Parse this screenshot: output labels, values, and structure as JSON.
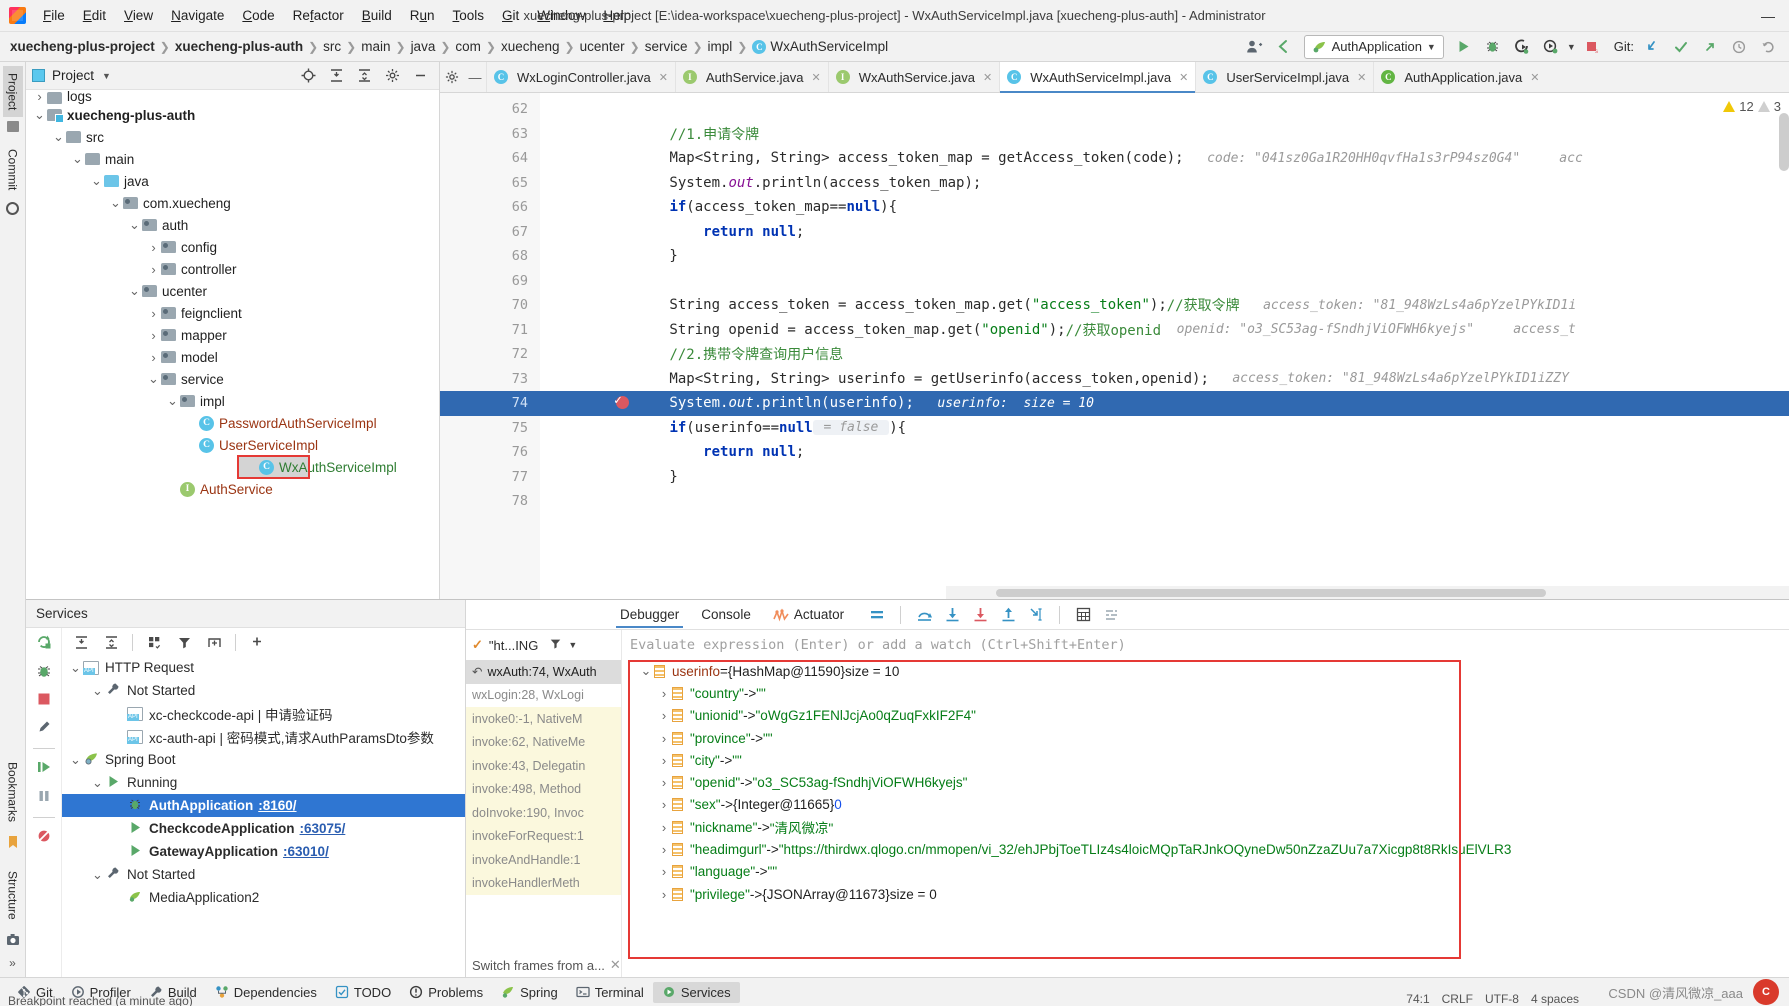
{
  "window": {
    "title": "xuecheng-plus-project [E:\\idea-workspace\\xuecheng-plus-project] - WxAuthServiceImpl.java [xuecheng-plus-auth] - Administrator",
    "minimize": "—",
    "maximize": "❐",
    "close": "✕"
  },
  "menu": [
    "File",
    "Edit",
    "View",
    "Navigate",
    "Code",
    "Refactor",
    "Build",
    "Run",
    "Tools",
    "Git",
    "Window",
    "Help"
  ],
  "breadcrumb": [
    {
      "label": "xuecheng-plus-project",
      "bold": true
    },
    {
      "label": "xuecheng-plus-auth",
      "bold": true
    },
    {
      "label": "src",
      "bold": false
    },
    {
      "label": "main",
      "bold": false
    },
    {
      "label": "java",
      "bold": false
    },
    {
      "label": "com",
      "bold": false
    },
    {
      "label": "xuecheng",
      "bold": false
    },
    {
      "label": "ucenter",
      "bold": false
    },
    {
      "label": "service",
      "bold": false
    },
    {
      "label": "impl",
      "bold": false
    },
    {
      "label": "WxAuthServiceImpl",
      "bold": false,
      "badge": "C"
    }
  ],
  "toolbar": {
    "run_config": "AuthApplication",
    "git_label": "Git:",
    "icons": {
      "avatar": "user-avatar-icon",
      "back": "back-arrow-icon",
      "run": "run-icon",
      "debug": "debug-icon",
      "coverage": "coverage-icon",
      "profile": "profile-icon",
      "stop": "stop-icon",
      "update_project": "update-project-icon",
      "commit": "commit-icon",
      "push": "push-icon",
      "history": "history-icon",
      "rollback": "rollback-icon"
    }
  },
  "project_panel": {
    "title": "Project",
    "tools": [
      "locate-icon",
      "expand-all-icon",
      "collapse-all-icon",
      "settings-icon",
      "hide-icon"
    ],
    "tree": [
      {
        "label": "logs",
        "depth": 2,
        "arrow": "right",
        "icon": "folder-grey",
        "style": "normal",
        "cut": true
      },
      {
        "label": "xuecheng-plus-auth",
        "depth": 2,
        "arrow": "down",
        "icon": "module",
        "style": "bold"
      },
      {
        "label": "src",
        "depth": 3,
        "arrow": "down",
        "icon": "folder-grey",
        "style": "normal"
      },
      {
        "label": "main",
        "depth": 4,
        "arrow": "down",
        "icon": "folder-grey",
        "style": "normal"
      },
      {
        "label": "java",
        "depth": 5,
        "arrow": "down",
        "icon": "folder-blue",
        "style": "normal"
      },
      {
        "label": "com.xuecheng",
        "depth": 6,
        "arrow": "down",
        "icon": "package",
        "style": "normal"
      },
      {
        "label": "auth",
        "depth": 7,
        "arrow": "down",
        "icon": "package",
        "style": "normal"
      },
      {
        "label": "config",
        "depth": 8,
        "arrow": "right",
        "icon": "package",
        "style": "normal"
      },
      {
        "label": "controller",
        "depth": 8,
        "arrow": "right",
        "icon": "package",
        "style": "normal"
      },
      {
        "label": "ucenter",
        "depth": 7,
        "arrow": "down",
        "icon": "package",
        "style": "normal"
      },
      {
        "label": "feignclient",
        "depth": 8,
        "arrow": "right",
        "icon": "package",
        "style": "normal"
      },
      {
        "label": "mapper",
        "depth": 8,
        "arrow": "right",
        "icon": "package",
        "style": "normal"
      },
      {
        "label": "model",
        "depth": 8,
        "arrow": "right",
        "icon": "package",
        "style": "normal"
      },
      {
        "label": "service",
        "depth": 8,
        "arrow": "down",
        "icon": "package",
        "style": "normal"
      },
      {
        "label": "impl",
        "depth": 9,
        "arrow": "down",
        "icon": "package",
        "style": "normal"
      },
      {
        "label": "PasswordAuthServiceImpl",
        "depth": 10,
        "arrow": "none",
        "icon": "class",
        "style": "cls"
      },
      {
        "label": "UserServiceImpl",
        "depth": 10,
        "arrow": "none",
        "icon": "class",
        "style": "cls"
      },
      {
        "label": "WxAuthServiceImpl",
        "depth": 10,
        "arrow": "none",
        "icon": "class",
        "style": "cls-green",
        "selected": true,
        "highlighted": true
      },
      {
        "label": "AuthService",
        "depth": 9,
        "arrow": "none",
        "icon": "interface",
        "style": "cls"
      }
    ]
  },
  "editor": {
    "tabs": [
      {
        "label": "WxLoginController.java",
        "badge": "C",
        "active": false
      },
      {
        "label": "AuthService.java",
        "badge": "I",
        "active": false
      },
      {
        "label": "WxAuthService.java",
        "badge": "I",
        "active": false
      },
      {
        "label": "WxAuthServiceImpl.java",
        "badge": "C",
        "active": true
      },
      {
        "label": "UserServiceImpl.java",
        "badge": "C",
        "active": false
      },
      {
        "label": "AuthApplication.java",
        "badge": "R",
        "active": false
      }
    ],
    "warnings": {
      "warning_count": "12",
      "weak_count": "3"
    },
    "lines": [
      {
        "n": "62",
        "segments": []
      },
      {
        "n": "63",
        "segments": [
          {
            "t": "        ",
            "c": "plain"
          },
          {
            "t": "//1.申请令牌",
            "c": "cmt-g"
          }
        ]
      },
      {
        "n": "64",
        "segments": [
          {
            "t": "        ",
            "c": "plain"
          },
          {
            "t": "Map",
            "c": "plain"
          },
          {
            "t": "<String, String> access_token_map = getAccess_token(code);",
            "c": "plain"
          },
          {
            "t": "   code: \"041sz0Ga1R20HH0qvfHa1s3rP94sz0G4\"     acc",
            "c": "hint"
          }
        ]
      },
      {
        "n": "65",
        "segments": [
          {
            "t": "        System.",
            "c": "plain"
          },
          {
            "t": "out",
            "c": "fld"
          },
          {
            "t": ".println(access_token_map);",
            "c": "plain"
          }
        ]
      },
      {
        "n": "66",
        "segments": [
          {
            "t": "        ",
            "c": "plain"
          },
          {
            "t": "if",
            "c": "kw"
          },
          {
            "t": "(access_token_map==",
            "c": "plain"
          },
          {
            "t": "null",
            "c": "kw"
          },
          {
            "t": "){",
            "c": "plain"
          }
        ],
        "fold": "start"
      },
      {
        "n": "67",
        "segments": [
          {
            "t": "            ",
            "c": "plain"
          },
          {
            "t": "return",
            "c": "kw"
          },
          {
            "t": " ",
            "c": "plain"
          },
          {
            "t": "null",
            "c": "kw"
          },
          {
            "t": ";",
            "c": "plain"
          }
        ]
      },
      {
        "n": "68",
        "segments": [
          {
            "t": "        }",
            "c": "plain"
          }
        ],
        "fold": "end"
      },
      {
        "n": "69",
        "segments": []
      },
      {
        "n": "70",
        "segments": [
          {
            "t": "        String access_token = access_token_map.get(",
            "c": "plain"
          },
          {
            "t": "\"access_token\"",
            "c": "str"
          },
          {
            "t": ");",
            "c": "plain"
          },
          {
            "t": "//获取令牌",
            "c": "cmt-g"
          },
          {
            "t": "   access_token: \"81_948WzLs4a6pYzelPYkID1i",
            "c": "hint"
          }
        ]
      },
      {
        "n": "71",
        "segments": [
          {
            "t": "        String openid = access_token_map.get(",
            "c": "plain"
          },
          {
            "t": "\"openid\"",
            "c": "str"
          },
          {
            "t": ");",
            "c": "plain"
          },
          {
            "t": "//获取openid",
            "c": "cmt-g"
          },
          {
            "t": "  openid: \"o3_SC53ag-fSndhjViOFWH6kyejs\"     access_t",
            "c": "hint"
          }
        ]
      },
      {
        "n": "72",
        "segments": [
          {
            "t": "        ",
            "c": "plain"
          },
          {
            "t": "//2.携带令牌查询用户信息",
            "c": "cmt-g"
          }
        ]
      },
      {
        "n": "73",
        "segments": [
          {
            "t": "        Map<String, String> userinfo = getUserinfo(access_token,openid);",
            "c": "plain"
          },
          {
            "t": "   access_token: \"81_948WzLs4a6pYzelPYkID1iZZY",
            "c": "hint"
          }
        ]
      },
      {
        "n": "74",
        "segments": [
          {
            "t": "        System.",
            "c": "plain"
          },
          {
            "t": "out",
            "c": "fld"
          },
          {
            "t": ".println(userinfo);",
            "c": "plain"
          },
          {
            "t": "   userinfo:  size = 10",
            "c": "hint"
          }
        ],
        "highlight": true,
        "breakpoint": true
      },
      {
        "n": "75",
        "segments": [
          {
            "t": "        ",
            "c": "plain"
          },
          {
            "t": "if",
            "c": "kw"
          },
          {
            "t": "(userinfo==",
            "c": "plain"
          },
          {
            "t": "null",
            "c": "kw"
          },
          {
            "t": " = false ",
            "c": "hint-b"
          },
          {
            "t": "){",
            "c": "plain"
          }
        ]
      },
      {
        "n": "76",
        "segments": [
          {
            "t": "            ",
            "c": "plain"
          },
          {
            "t": "return",
            "c": "kw"
          },
          {
            "t": " ",
            "c": "plain"
          },
          {
            "t": "null",
            "c": "kw"
          },
          {
            "t": ";",
            "c": "plain"
          }
        ]
      },
      {
        "n": "77",
        "segments": [
          {
            "t": "        }",
            "c": "plain"
          }
        ],
        "fold": "end"
      },
      {
        "n": "78",
        "segments": []
      }
    ]
  },
  "services": {
    "title": "Services",
    "tools": [
      "rerun-icon",
      "debug-icon",
      "stop-icon",
      "settings-icon",
      "resume-icon",
      "pause-icon",
      "expand-all-icon",
      "collapse-all-icon",
      "group-icon",
      "filter-icon",
      "add-tab-icon",
      "add-icon"
    ],
    "tree": [
      {
        "label": "HTTP Request",
        "depth": 1,
        "arrow": "down",
        "icon": "api",
        "style": "normal"
      },
      {
        "label": "Not Started",
        "depth": 2,
        "arrow": "down",
        "icon": "wrench",
        "style": "normal"
      },
      {
        "label": "xc-checkcode-api  |  申请验证码",
        "depth": 3,
        "arrow": "none",
        "icon": "api",
        "style": "normal"
      },
      {
        "label": "xc-auth-api  |  密码模式,请求AuthParamsDto参数",
        "depth": 3,
        "arrow": "none",
        "icon": "api",
        "style": "normal"
      },
      {
        "label": "Spring Boot",
        "depth": 1,
        "arrow": "down",
        "icon": "spring",
        "style": "normal"
      },
      {
        "label": "Running",
        "depth": 2,
        "arrow": "down",
        "icon": "play-green",
        "style": "normal"
      },
      {
        "label": "AuthApplication",
        "link": ":8160/",
        "depth": 3,
        "arrow": "none",
        "icon": "bug-green",
        "style": "bold",
        "selected": true
      },
      {
        "label": "CheckcodeApplication",
        "link": ":63075/",
        "depth": 3,
        "arrow": "none",
        "icon": "play-green",
        "style": "bold"
      },
      {
        "label": "GatewayApplication",
        "link": ":63010/",
        "depth": 3,
        "arrow": "none",
        "icon": "play-green",
        "style": "bold"
      },
      {
        "label": "Not Started",
        "depth": 2,
        "arrow": "down",
        "icon": "wrench",
        "style": "normal"
      },
      {
        "label": "MediaApplication2",
        "depth": 3,
        "arrow": "none",
        "icon": "spring-small",
        "style": "normal"
      }
    ]
  },
  "debugger": {
    "tabs": [
      {
        "label": "Debugger",
        "active": true
      },
      {
        "label": "Console",
        "active": false
      },
      {
        "label": "Actuator",
        "active": false,
        "icon": "actuator-icon"
      }
    ],
    "toolbar_icons": [
      "mute-breakpoints-icon",
      "step-over-icon",
      "step-into-icon",
      "force-step-into-icon",
      "step-out-icon",
      "run-to-cursor-icon",
      "evaluate-icon",
      "settings-icon"
    ],
    "thread_label": "\"ht...ING",
    "evaluate_placeholder": "Evaluate expression (Enter) or add a watch (Ctrl+Shift+Enter)",
    "switch_frames": "Switch frames from a...",
    "frames": [
      {
        "label": "wxAuth:74, WxAuth",
        "current": true
      },
      {
        "label": "wxLogin:28, WxLogi",
        "current": false
      },
      {
        "label": "invoke0:-1, NativeM",
        "library": true
      },
      {
        "label": "invoke:62, NativeMe",
        "library": true
      },
      {
        "label": "invoke:43, Delegatin",
        "library": true
      },
      {
        "label": "invoke:498, Method",
        "library": true
      },
      {
        "label": "doInvoke:190, Invoc",
        "library": true
      },
      {
        "label": "invokeForRequest:1",
        "library": true
      },
      {
        "label": "invokeAndHandle:1",
        "library": true
      },
      {
        "label": "invokeHandlerMeth",
        "library": true
      }
    ],
    "variables": [
      {
        "depth": 0,
        "arrow": "down",
        "name": "userinfo",
        "op": " = ",
        "obj": "{HashMap@11590}",
        "extra": " size = 10"
      },
      {
        "depth": 1,
        "arrow": "right",
        "name": "\"country\"",
        "op": " -> ",
        "value": "\"\""
      },
      {
        "depth": 1,
        "arrow": "right",
        "name": "\"unionid\"",
        "op": " -> ",
        "value": "\"oWgGz1FENlJcjAo0qZuqFxkIF2F4\""
      },
      {
        "depth": 1,
        "arrow": "right",
        "name": "\"province\"",
        "op": " -> ",
        "value": "\"\""
      },
      {
        "depth": 1,
        "arrow": "right",
        "name": "\"city\"",
        "op": " -> ",
        "value": "\"\""
      },
      {
        "depth": 1,
        "arrow": "right",
        "name": "\"openid\"",
        "op": " -> ",
        "value": "\"o3_SC53ag-fSndhjViOFWH6kyejs\""
      },
      {
        "depth": 1,
        "arrow": "right",
        "name": "\"sex\"",
        "op": " -> ",
        "obj": "{Integer@11665}",
        "num": "0"
      },
      {
        "depth": 1,
        "arrow": "right",
        "name": "\"nickname\"",
        "op": " -> ",
        "value": "\"清风微凉\""
      },
      {
        "depth": 1,
        "arrow": "right",
        "name": "\"headimgurl\"",
        "op": " -> ",
        "value": "\"https://thirdwx.qlogo.cn/mmopen/vi_32/ehJPbjToeTLIz4s4loicMQpTaRJnkOQyneDw50nZzaZUu7a7Xicgp8t8RkIsuElVLR3"
      },
      {
        "depth": 1,
        "arrow": "right",
        "name": "\"language\"",
        "op": " -> ",
        "value": "\"\""
      },
      {
        "depth": 1,
        "arrow": "right",
        "name": "\"privilege\"",
        "op": " -> ",
        "obj": "{JSONArray@11673}",
        "extra": " size = 0"
      }
    ]
  },
  "left_rail": {
    "tabs": [
      "Project",
      "Commit"
    ],
    "bottom_tabs": [
      "Bookmarks",
      "Structure"
    ]
  },
  "statusbar": {
    "items": [
      {
        "label": "Git",
        "icon": "git-icon"
      },
      {
        "label": "Profiler",
        "icon": "profiler-icon"
      },
      {
        "label": "Build",
        "icon": "build-icon"
      },
      {
        "label": "Dependencies",
        "icon": "dependencies-icon"
      },
      {
        "label": "TODO",
        "icon": "todo-icon"
      },
      {
        "label": "Problems",
        "icon": "problems-icon"
      },
      {
        "label": "Spring",
        "icon": "spring-icon"
      },
      {
        "label": "Terminal",
        "icon": "terminal-icon"
      },
      {
        "label": "Services",
        "icon": "services-icon",
        "active": true
      }
    ],
    "message": "Breakpoint reached (a minute ago)",
    "position": "74:1",
    "line_sep": "CRLF",
    "encoding": "UTF-8",
    "indent": "4 spaces",
    "watermark": "CSDN @清风微凉_aaa"
  },
  "colors": {
    "accent_blue": "#2f76d2",
    "highlight_blue": "#3069b1",
    "red_frame": "#e53935",
    "green_run": "#59a869",
    "string_green": "#067d17",
    "keyword_blue": "#0033b3"
  }
}
